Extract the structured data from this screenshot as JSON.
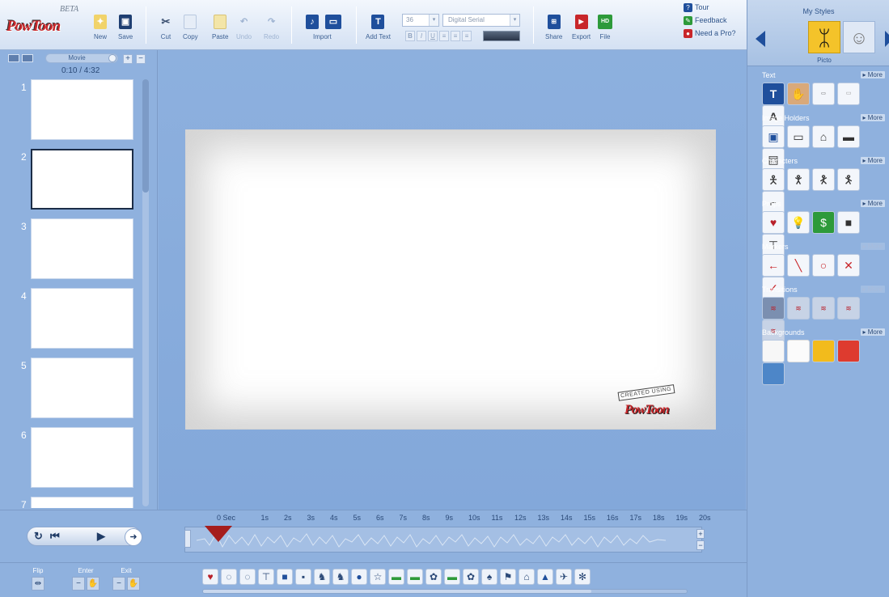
{
  "app": {
    "logo": "PowToon",
    "beta": "BETA",
    "watermark_top": "CREATED USING",
    "watermark_brand": "PowToon"
  },
  "toolbar": {
    "new": "New",
    "save": "Save",
    "cut": "Cut",
    "copy": "Copy",
    "paste": "Paste",
    "undo": "Undo",
    "redo": "Redo",
    "import": "Import",
    "add_text": "Add Text",
    "font_size": "36",
    "font_name": "Digital Serial",
    "bold": "B",
    "italic": "I",
    "underline": "U",
    "share": "Share",
    "export": "Export",
    "file": "File",
    "hd_badge": "HD"
  },
  "help": {
    "tour": "Tour",
    "feedback": "Feedback",
    "need_pro": "Need a Pro?"
  },
  "slides_panel": {
    "movie_label": "Movie",
    "time": "0:10 / 4:32",
    "slides": [
      "1",
      "2",
      "3",
      "4",
      "5",
      "6",
      "7"
    ],
    "selected_slide": "2"
  },
  "styles": {
    "title": "My Styles",
    "selected_style": "Picto",
    "more": "▸ More",
    "categories": [
      "Text",
      "Image Holders",
      "Characters",
      "Props",
      "Markers",
      "Transitions",
      "Backgrounds"
    ]
  },
  "timeline": {
    "ticks": [
      "0 Sec",
      "1s",
      "2s",
      "3s",
      "4s",
      "5s",
      "6s",
      "7s",
      "8s",
      "9s",
      "10s",
      "11s",
      "12s",
      "13s",
      "14s",
      "15s",
      "16s",
      "17s",
      "18s",
      "19s",
      "20s"
    ],
    "flip": "Flip",
    "enter": "Enter",
    "exit": "Exit"
  },
  "colors": {
    "accent": "#1f4f9c",
    "panel_bg": "#8fb1de",
    "playhead": "#a51d1d",
    "style_highlight": "#f4c32a"
  }
}
